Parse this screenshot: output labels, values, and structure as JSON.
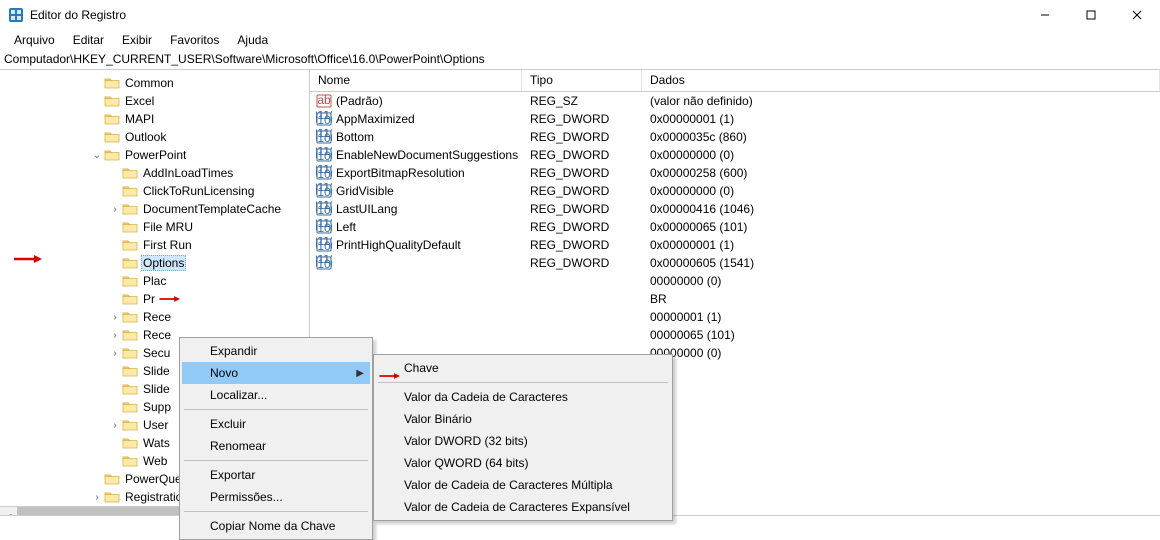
{
  "titlebar": {
    "title": "Editor do Registro"
  },
  "menubar": {
    "items": [
      "Arquivo",
      "Editar",
      "Exibir",
      "Favoritos",
      "Ajuda"
    ]
  },
  "address": "Computador\\HKEY_CURRENT_USER\\Software\\Microsoft\\Office\\16.0\\PowerPoint\\Options",
  "tree": [
    {
      "indent": 5,
      "expander": "",
      "label": "Common"
    },
    {
      "indent": 5,
      "expander": "",
      "label": "Excel"
    },
    {
      "indent": 5,
      "expander": "",
      "label": "MAPI"
    },
    {
      "indent": 5,
      "expander": "",
      "label": "Outlook"
    },
    {
      "indent": 5,
      "expander": "v",
      "label": "PowerPoint"
    },
    {
      "indent": 6,
      "expander": "",
      "label": "AddInLoadTimes"
    },
    {
      "indent": 6,
      "expander": "",
      "label": "ClickToRunLicensing"
    },
    {
      "indent": 6,
      "expander": ">",
      "label": "DocumentTemplateCache"
    },
    {
      "indent": 6,
      "expander": "",
      "label": "File MRU"
    },
    {
      "indent": 6,
      "expander": "",
      "label": "First Run"
    },
    {
      "indent": 6,
      "expander": "",
      "label": "Options",
      "selected": true
    },
    {
      "indent": 6,
      "expander": "",
      "label": "Plac"
    },
    {
      "indent": 6,
      "expander": "",
      "label": "Pr"
    },
    {
      "indent": 6,
      "expander": ">",
      "label": "Rece"
    },
    {
      "indent": 6,
      "expander": ">",
      "label": "Rece"
    },
    {
      "indent": 6,
      "expander": ">",
      "label": "Secu"
    },
    {
      "indent": 6,
      "expander": "",
      "label": "Slide"
    },
    {
      "indent": 6,
      "expander": "",
      "label": "Slide"
    },
    {
      "indent": 6,
      "expander": "",
      "label": "Supp"
    },
    {
      "indent": 6,
      "expander": ">",
      "label": "User"
    },
    {
      "indent": 6,
      "expander": "",
      "label": "Wats"
    },
    {
      "indent": 6,
      "expander": "",
      "label": "Web"
    },
    {
      "indent": 5,
      "expander": "",
      "label": "PowerQuery"
    },
    {
      "indent": 5,
      "expander": ">",
      "label": "Registration"
    }
  ],
  "list": {
    "headers": {
      "name": "Nome",
      "type": "Tipo",
      "data": "Dados"
    },
    "rows": [
      {
        "icon": "sz",
        "name": "(Padrão)",
        "type": "REG_SZ",
        "data": "(valor não definido)"
      },
      {
        "icon": "dw",
        "name": "AppMaximized",
        "type": "REG_DWORD",
        "data": "0x00000001 (1)"
      },
      {
        "icon": "dw",
        "name": "Bottom",
        "type": "REG_DWORD",
        "data": "0x0000035c (860)"
      },
      {
        "icon": "dw",
        "name": "EnableNewDocumentSuggestions",
        "type": "REG_DWORD",
        "data": "0x00000000 (0)"
      },
      {
        "icon": "dw",
        "name": "ExportBitmapResolution",
        "type": "REG_DWORD",
        "data": "0x00000258 (600)"
      },
      {
        "icon": "dw",
        "name": "GridVisible",
        "type": "REG_DWORD",
        "data": "0x00000000 (0)"
      },
      {
        "icon": "dw",
        "name": "LastUILang",
        "type": "REG_DWORD",
        "data": "0x00000416 (1046)"
      },
      {
        "icon": "dw",
        "name": "Left",
        "type": "REG_DWORD",
        "data": "0x00000065 (101)"
      },
      {
        "icon": "dw",
        "name": "PrintHighQualityDefault",
        "type": "REG_DWORD",
        "data": "0x00000001 (1)"
      },
      {
        "icon": "dw",
        "name": "",
        "type": "REG_DWORD",
        "data": "0x00000605 (1541)"
      },
      {
        "icon": "dw",
        "name": "",
        "type": "",
        "data": "00000000 (0)"
      },
      {
        "icon": "dw",
        "name": "",
        "type": "",
        "data": "BR"
      },
      {
        "icon": "dw",
        "name": "",
        "type": "",
        "data": "00000001 (1)"
      },
      {
        "icon": "dw",
        "name": "",
        "type": "",
        "data": "00000065 (101)"
      },
      {
        "icon": "dw",
        "name": "",
        "type": "",
        "data": "00000000 (0)"
      }
    ]
  },
  "context_menu_1": {
    "items": [
      {
        "label": "Expandir"
      },
      {
        "label": "Novo",
        "submenu": true,
        "highlight": true
      },
      {
        "label": "Localizar..."
      },
      {
        "sep": true
      },
      {
        "label": "Excluir"
      },
      {
        "label": "Renomear"
      },
      {
        "sep": true
      },
      {
        "label": "Exportar"
      },
      {
        "label": "Permissões..."
      },
      {
        "sep": true
      },
      {
        "label": "Copiar Nome da Chave"
      }
    ]
  },
  "context_menu_2": {
    "items": [
      {
        "label": "Chave"
      },
      {
        "sep": true
      },
      {
        "label": "Valor da Cadeia de Caracteres"
      },
      {
        "label": "Valor Binário"
      },
      {
        "label": "Valor DWORD (32 bits)"
      },
      {
        "label": "Valor QWORD (64 bits)"
      },
      {
        "label": "Valor de Cadeia de Caracteres Múltipla"
      },
      {
        "label": "Valor de Cadeia de Caracteres Expansível"
      }
    ]
  }
}
